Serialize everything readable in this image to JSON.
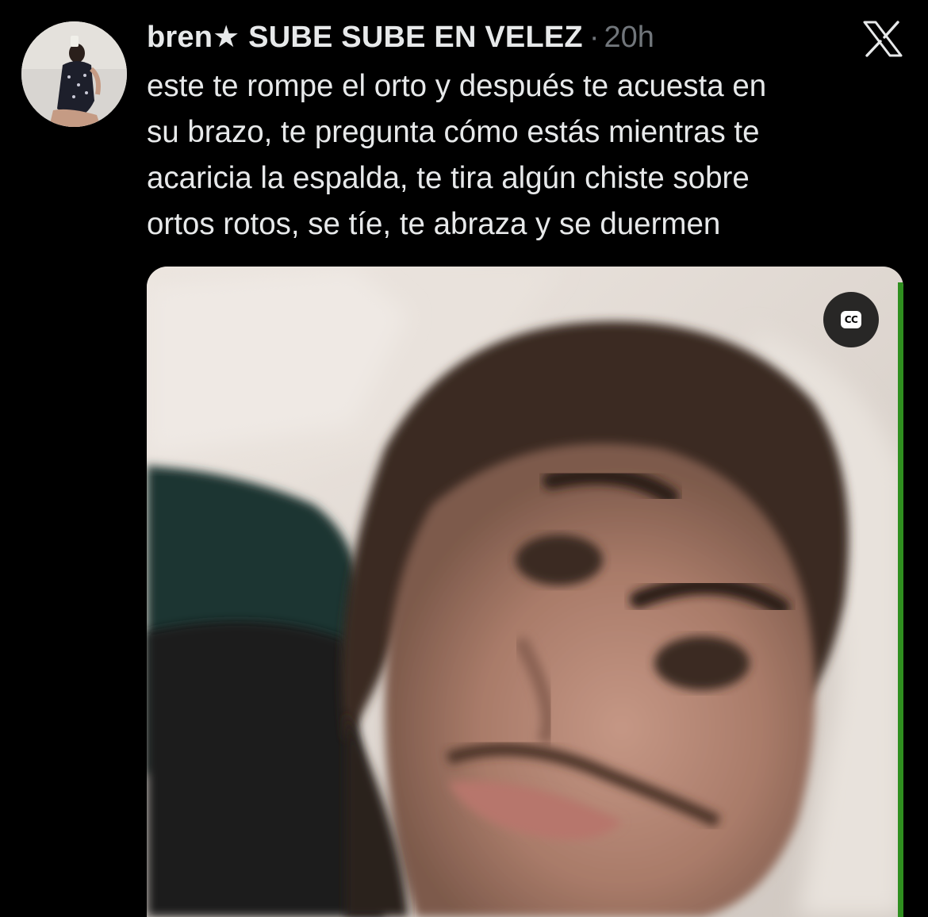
{
  "tweet": {
    "display_name": "bren★ SUBE SUBE EN VELEZ",
    "separator": "·",
    "timestamp": "20h",
    "text": "este te rompe el orto y después te acuesta en\nsu brazo, te pregunta cómo estás mientras te\nacaricia la espalda, te tira algún chiste sobre\nortos rotos, se tíe, te abraza y se duermen"
  },
  "media": {
    "cc_label": "CC"
  },
  "icons": {
    "platform_logo": "x-logo-icon",
    "captions": "closed-captions-icon"
  }
}
